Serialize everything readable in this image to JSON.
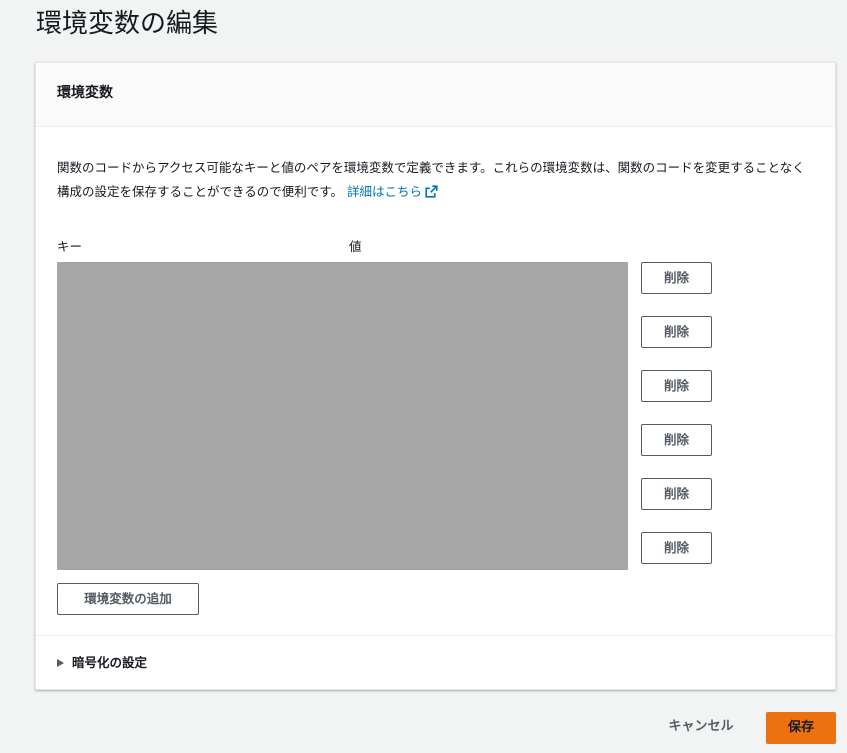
{
  "page": {
    "title": "環境変数の編集"
  },
  "panel": {
    "title": "環境変数",
    "description": "関数のコードからアクセス可能なキーと値のペアを環境変数で定義できます。これらの環境変数は、関数のコードを変更することなく構成の設定を保存することができるので便利です。",
    "learn_more_label": "詳細はこちら",
    "learn_more_icon": "external-link-icon",
    "columns": {
      "key": "キー",
      "value": "値"
    },
    "rows": [
      {
        "delete_label": "削除"
      },
      {
        "delete_label": "削除"
      },
      {
        "delete_label": "削除"
      },
      {
        "delete_label": "削除"
      },
      {
        "delete_label": "削除"
      },
      {
        "delete_label": "削除"
      }
    ],
    "add_label": "環境変数の追加",
    "encryption": {
      "label": "暗号化の設定",
      "icon": "caret-right-icon",
      "expanded": false
    }
  },
  "footer": {
    "cancel_label": "キャンセル",
    "save_label": "保存"
  },
  "colors": {
    "primary": "#ec7211",
    "link": "#0073bb",
    "redacted": "#a6a6a6"
  }
}
